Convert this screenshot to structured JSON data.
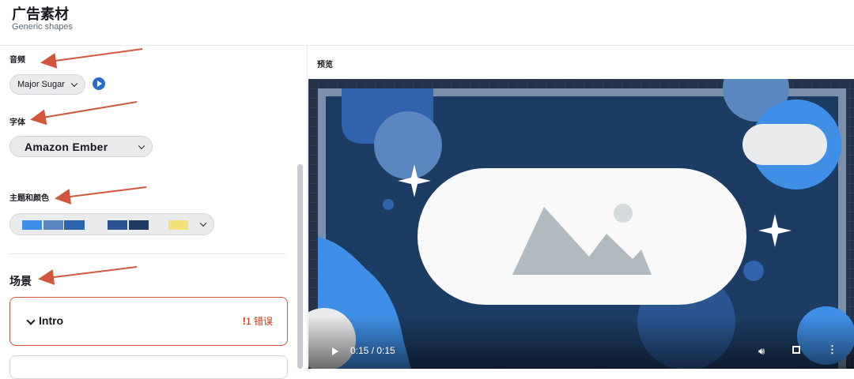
{
  "header": {
    "title": "广告素材",
    "subtitle": "Generic shapes"
  },
  "audio": {
    "label": "音频",
    "selected": "Major Sugar"
  },
  "font": {
    "label": "字体",
    "selected": "Amazon Ember"
  },
  "theme": {
    "label": "主题和颜色",
    "colors": [
      "#3f8fe6",
      "#5b87c0",
      "#2e64ad",
      "#e9ebed",
      "#2a5591",
      "#1f3b63",
      "#f4e17b"
    ]
  },
  "scenes": {
    "title": "场景",
    "items": [
      {
        "name": "Intro",
        "error_text": "1 错误"
      }
    ]
  },
  "preview": {
    "title": "预览",
    "player": {
      "time": "0:15 / 0:15"
    }
  },
  "accent": {
    "error": "#d13212",
    "annotation_arrow": "#d0573c"
  }
}
